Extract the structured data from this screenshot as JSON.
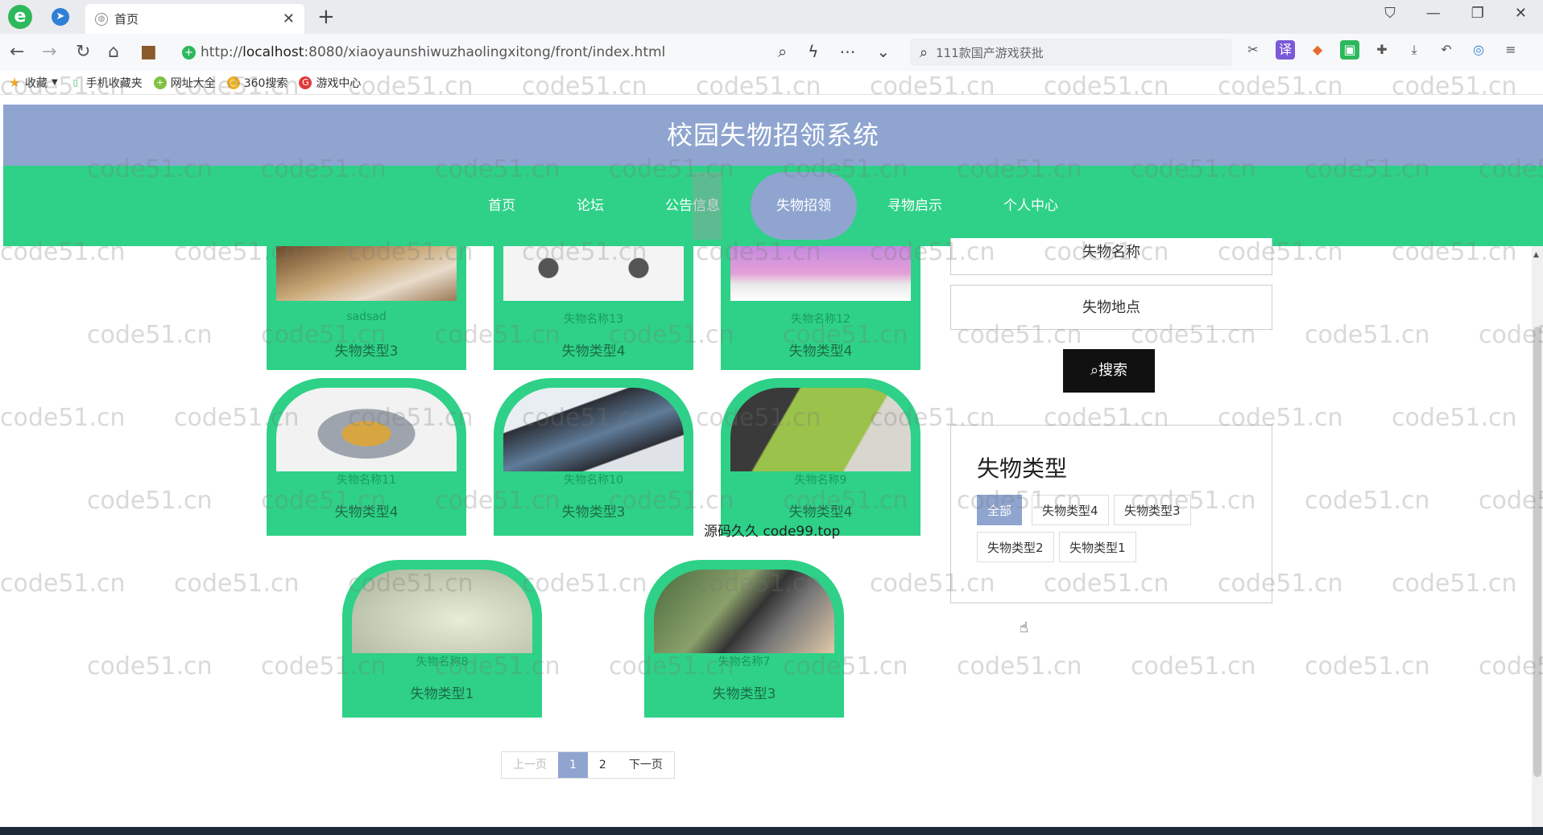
{
  "browser": {
    "tab_title": "首页",
    "url_prefix": "http://",
    "url_host": "localhost",
    "url_rest": ":8080/xiaoyaunshiwuzhaolingxitong/front/index.html",
    "search_text": "111款国产游戏获批",
    "bookmarks": [
      "收藏",
      "手机收藏夹",
      "网址大全",
      "360搜索",
      "游戏中心"
    ]
  },
  "site": {
    "title": "校园失物招领系统",
    "nav": [
      "首页",
      "论坛",
      "公告信息",
      "失物招领",
      "寻物启示",
      "个人中心"
    ]
  },
  "cards": [
    {
      "name": "sadsad",
      "type": "失物类型3"
    },
    {
      "name": "失物名称13",
      "type": "失物类型4"
    },
    {
      "name": "失物名称12",
      "type": "失物类型4"
    },
    {
      "name": "失物名称11",
      "type": "失物类型4"
    },
    {
      "name": "失物名称10",
      "type": "失物类型3"
    },
    {
      "name": "失物名称9",
      "type": "失物类型4"
    },
    {
      "name": "失物名称8",
      "type": "失物类型1"
    },
    {
      "name": "失物名称7",
      "type": "失物类型3"
    }
  ],
  "sidebar": {
    "name_field": "失物名称",
    "place_field": "失物地点",
    "search_button": "搜索",
    "types_title": "失物类型",
    "types": [
      "全部",
      "失物类型4",
      "失物类型3",
      "失物类型2",
      "失物类型1"
    ]
  },
  "pager": {
    "prev": "上一页",
    "pages": [
      "1",
      "2"
    ],
    "next": "下一页"
  },
  "overlay_text": "源码久久 code99.top",
  "watermark_text": "code51.cn"
}
